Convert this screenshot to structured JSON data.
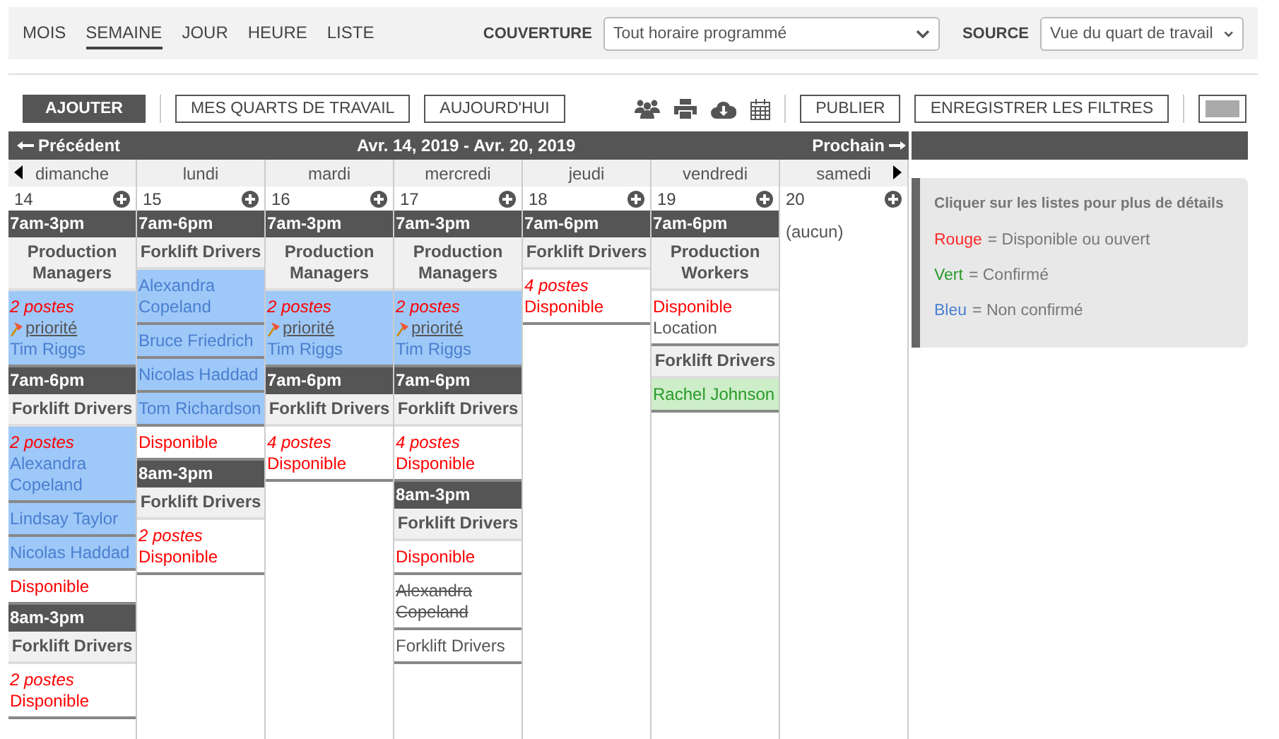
{
  "views": [
    {
      "label": "MOIS",
      "selected": false
    },
    {
      "label": "SEMAINE",
      "selected": true
    },
    {
      "label": "JOUR",
      "selected": false
    },
    {
      "label": "HEURE",
      "selected": false
    },
    {
      "label": "LISTE",
      "selected": false
    }
  ],
  "filters": [
    {
      "label": "COUVERTURE",
      "value": "Tout horaire programmé"
    },
    {
      "label": "SOURCE",
      "value": "Vue du quart de travail"
    }
  ],
  "toolbar": {
    "add": "AJOUTER",
    "left_buttons": [
      "MES QUARTS DE TRAVAIL",
      "AUJOURD'HUI"
    ],
    "right_buttons": [
      "PUBLIER",
      "ENREGISTRER LES FILTRES"
    ]
  },
  "calendar": {
    "previous": "Précédent",
    "range": "Avr. 14, 2019 - Avr. 20, 2019",
    "next": "Prochain",
    "days": [
      {
        "name": "dimanche",
        "date": "14",
        "items": [
          {
            "kind": "time",
            "text": "7am-3pm"
          },
          {
            "kind": "role",
            "text": "Production Managers"
          },
          {
            "kind": "unconfirmed",
            "lines": [
              {
                "kind": "postes",
                "text": "2 postes"
              },
              {
                "kind": "priority",
                "text": "priorité"
              },
              {
                "kind": "name",
                "text": "Tim Riggs"
              }
            ]
          },
          {
            "kind": "time",
            "text": "7am-6pm"
          },
          {
            "kind": "role",
            "text": "Forklift Drivers"
          },
          {
            "kind": "unconfirmed",
            "lines": [
              {
                "kind": "postes",
                "text": "2 postes"
              },
              {
                "kind": "name",
                "text": "Alexandra Copeland"
              }
            ]
          },
          {
            "kind": "unconfirmed",
            "lines": [
              {
                "kind": "name",
                "text": "Lindsay Taylor"
              }
            ]
          },
          {
            "kind": "unconfirmed",
            "lines": [
              {
                "kind": "name",
                "text": "Nicolas Haddad"
              }
            ]
          },
          {
            "kind": "open",
            "lines": [
              {
                "kind": "available",
                "text": "Disponible"
              }
            ]
          },
          {
            "kind": "time",
            "text": "8am-3pm"
          },
          {
            "kind": "role",
            "text": "Forklift Drivers"
          },
          {
            "kind": "open",
            "lines": [
              {
                "kind": "postes",
                "text": "2 postes"
              },
              {
                "kind": "available",
                "text": "Disponible"
              }
            ]
          }
        ]
      },
      {
        "name": "lundi",
        "date": "15",
        "items": [
          {
            "kind": "time",
            "text": "7am-6pm"
          },
          {
            "kind": "role",
            "text": "Forklift Drivers"
          },
          {
            "kind": "unconfirmed",
            "lines": [
              {
                "kind": "name",
                "text": "Alexandra Copeland"
              }
            ]
          },
          {
            "kind": "unconfirmed",
            "lines": [
              {
                "kind": "name",
                "text": "Bruce Friedrich"
              }
            ]
          },
          {
            "kind": "unconfirmed",
            "lines": [
              {
                "kind": "name",
                "text": "Nicolas Haddad"
              }
            ]
          },
          {
            "kind": "unconfirmed",
            "lines": [
              {
                "kind": "name",
                "text": "Tom Richardson"
              }
            ]
          },
          {
            "kind": "open",
            "lines": [
              {
                "kind": "available",
                "text": "Disponible"
              }
            ]
          },
          {
            "kind": "time",
            "text": "8am-3pm"
          },
          {
            "kind": "role",
            "text": "Forklift Drivers"
          },
          {
            "kind": "open",
            "lines": [
              {
                "kind": "postes",
                "text": "2 postes"
              },
              {
                "kind": "available",
                "text": "Disponible"
              }
            ]
          }
        ]
      },
      {
        "name": "mardi",
        "date": "16",
        "items": [
          {
            "kind": "time",
            "text": "7am-3pm"
          },
          {
            "kind": "role",
            "text": "Production Managers"
          },
          {
            "kind": "unconfirmed",
            "lines": [
              {
                "kind": "postes",
                "text": "2 postes"
              },
              {
                "kind": "priority",
                "text": "priorité"
              },
              {
                "kind": "name",
                "text": "Tim Riggs"
              }
            ]
          },
          {
            "kind": "time",
            "text": "7am-6pm"
          },
          {
            "kind": "role",
            "text": "Forklift Drivers"
          },
          {
            "kind": "open",
            "lines": [
              {
                "kind": "postes",
                "text": "4 postes"
              },
              {
                "kind": "available",
                "text": "Disponible"
              }
            ]
          }
        ]
      },
      {
        "name": "mercredi",
        "date": "17",
        "items": [
          {
            "kind": "time",
            "text": "7am-3pm"
          },
          {
            "kind": "role",
            "text": "Production Managers"
          },
          {
            "kind": "unconfirmed",
            "lines": [
              {
                "kind": "postes",
                "text": "2 postes"
              },
              {
                "kind": "priority",
                "text": "priorité"
              },
              {
                "kind": "name",
                "text": "Tim Riggs"
              }
            ]
          },
          {
            "kind": "time",
            "text": "7am-6pm"
          },
          {
            "kind": "role",
            "text": "Forklift Drivers"
          },
          {
            "kind": "open",
            "lines": [
              {
                "kind": "postes",
                "text": "4 postes"
              },
              {
                "kind": "available",
                "text": "Disponible"
              }
            ]
          },
          {
            "kind": "time",
            "text": "8am-3pm"
          },
          {
            "kind": "role",
            "text": "Forklift Drivers"
          },
          {
            "kind": "open",
            "lines": [
              {
                "kind": "available",
                "text": "Disponible"
              }
            ]
          },
          {
            "kind": "cancelled",
            "lines": [
              {
                "kind": "name",
                "text": "Alexandra Copeland"
              }
            ]
          },
          {
            "kind": "plain",
            "lines": [
              {
                "kind": "name",
                "text": "Forklift Drivers"
              }
            ]
          }
        ]
      },
      {
        "name": "jeudi",
        "date": "18",
        "items": [
          {
            "kind": "time",
            "text": "7am-6pm"
          },
          {
            "kind": "role",
            "text": "Forklift Drivers"
          },
          {
            "kind": "open",
            "lines": [
              {
                "kind": "postes",
                "text": "4 postes"
              },
              {
                "kind": "available",
                "text": "Disponible"
              }
            ]
          }
        ]
      },
      {
        "name": "vendredi",
        "date": "19",
        "items": [
          {
            "kind": "time",
            "text": "7am-6pm"
          },
          {
            "kind": "role",
            "text": "Production Workers"
          },
          {
            "kind": "open",
            "lines": [
              {
                "kind": "available",
                "text": "Disponible"
              },
              {
                "kind": "location",
                "text": "Location"
              }
            ]
          },
          {
            "kind": "role",
            "text": "Forklift Drivers"
          },
          {
            "kind": "confirmed",
            "lines": [
              {
                "kind": "name",
                "text": "Rachel Johnson"
              }
            ]
          }
        ]
      },
      {
        "name": "samedi",
        "date": "20",
        "items": [
          {
            "kind": "none",
            "text": "(aucun)"
          }
        ]
      }
    ]
  },
  "legend": {
    "title": "Cliquer sur les listes pour plus de détails",
    "items": [
      {
        "label": "Rouge",
        "text": "= Disponible ou ouvert",
        "color": "#ff2a2a"
      },
      {
        "label": "Vert",
        "text": "= Confirmé",
        "color": "#2a9a2a"
      },
      {
        "label": "Bleu",
        "text": "= Non confirmé",
        "color": "#4a7fd0"
      }
    ]
  }
}
